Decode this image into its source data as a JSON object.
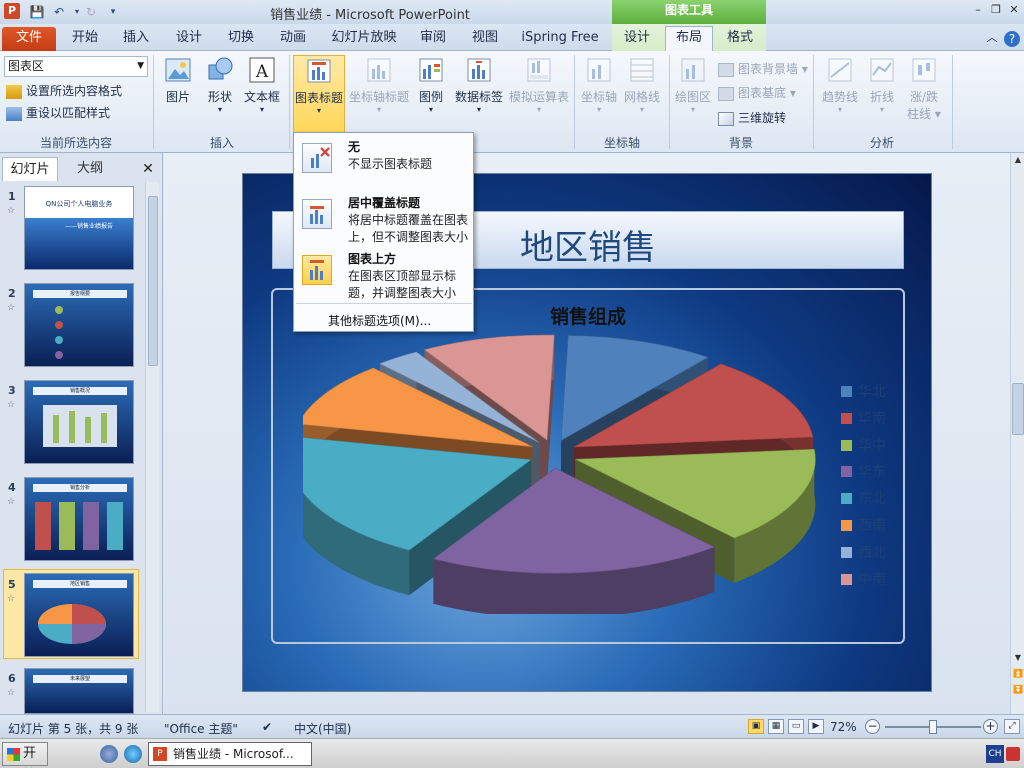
{
  "titlebar": {
    "window_title": "销售业绩 - Microsoft PowerPoint",
    "app_icon_letter": "P",
    "contextual_tab_group": "图表工具",
    "win_minimize": "–",
    "win_restore": "❐",
    "win_close": "✕"
  },
  "tabs": {
    "file": "文件",
    "home": "开始",
    "insert": "插入",
    "design": "设计",
    "transitions": "切换",
    "animations": "动画",
    "slideshow": "幻灯片放映",
    "review": "审阅",
    "view": "视图",
    "ispring": "iSpring Free",
    "ctx_design": "设计",
    "ctx_layout": "布局",
    "ctx_format": "格式"
  },
  "ribbon": {
    "current_selection": {
      "dropdown_value": "图表区",
      "format_selection": "设置所选内容格式",
      "reset_style": "重设以匹配样式",
      "group_label": "当前所选内容"
    },
    "insert": {
      "picture": "图片",
      "shapes": "形状",
      "textbox": "文本框",
      "group_label": "插入"
    },
    "labels": {
      "chart_title": "图表标题",
      "axis_titles": "坐标轴标题",
      "legend": "图例",
      "data_labels": "数据标签",
      "data_table": "模拟运算表"
    },
    "axes": {
      "axes": "坐标轴",
      "gridlines": "网格线",
      "group_label": "坐标轴"
    },
    "background": {
      "plot_area": "绘图区",
      "chart_wall": "图表背景墙",
      "chart_floor": "图表基底",
      "rotation_3d": "三维旋转",
      "group_label": "背景"
    },
    "analysis": {
      "trendline": "趋势线",
      "lines": "折线",
      "updown_bars_1": "涨/跌",
      "updown_bars_2": "柱线",
      "group_label": "分析"
    }
  },
  "dropdown_menu": {
    "none_title": "无",
    "none_desc": "不显示图表标题",
    "centered_title": "居中覆盖标题",
    "centered_desc": "将居中标题覆盖在图表上，但不调整图表大小",
    "above_title": "图表上方",
    "above_desc": "在图表区顶部显示标题，并调整图表大小",
    "more_options": "其他标题选项(M)..."
  },
  "left_pane": {
    "tab_slides": "幻灯片",
    "tab_outline": "大纲",
    "close": "✕",
    "thumbnails": [
      {
        "num": "1",
        "caption": "QN公司个人电脑业务",
        "sub": "——销售业绩报告"
      },
      {
        "num": "2",
        "caption": "报告纲要"
      },
      {
        "num": "3",
        "caption": "销售概况"
      },
      {
        "num": "4",
        "caption": "销售分析"
      },
      {
        "num": "5",
        "caption": "地区销售"
      },
      {
        "num": "6",
        "caption": "未来展望"
      }
    ]
  },
  "slide": {
    "title": "地区销售"
  },
  "chart_data": {
    "type": "pie",
    "title": "销售组成",
    "categories": [
      "华北",
      "华南",
      "华中",
      "华东",
      "东北",
      "西南",
      "西北",
      "中南"
    ],
    "values": [
      10,
      13,
      15,
      20,
      20,
      10,
      3,
      9
    ],
    "colors": [
      "#4f81bd",
      "#c0504d",
      "#9bbb59",
      "#8064a2",
      "#4bacc6",
      "#f79646",
      "#95b3d7",
      "#d99694"
    ],
    "legend_position": "right",
    "style": "3d-exploded (estimated values)"
  },
  "statusbar": {
    "slide_info": "幻灯片 第 5 张，共 9 张",
    "theme": "\"Office 主题\"",
    "language": "中文(中国)",
    "zoom": "72%",
    "zoom_fraction": 0.5
  },
  "taskbar": {
    "start": "开始",
    "task_label": "销售业绩 - Microsof...",
    "ime": "CH"
  }
}
